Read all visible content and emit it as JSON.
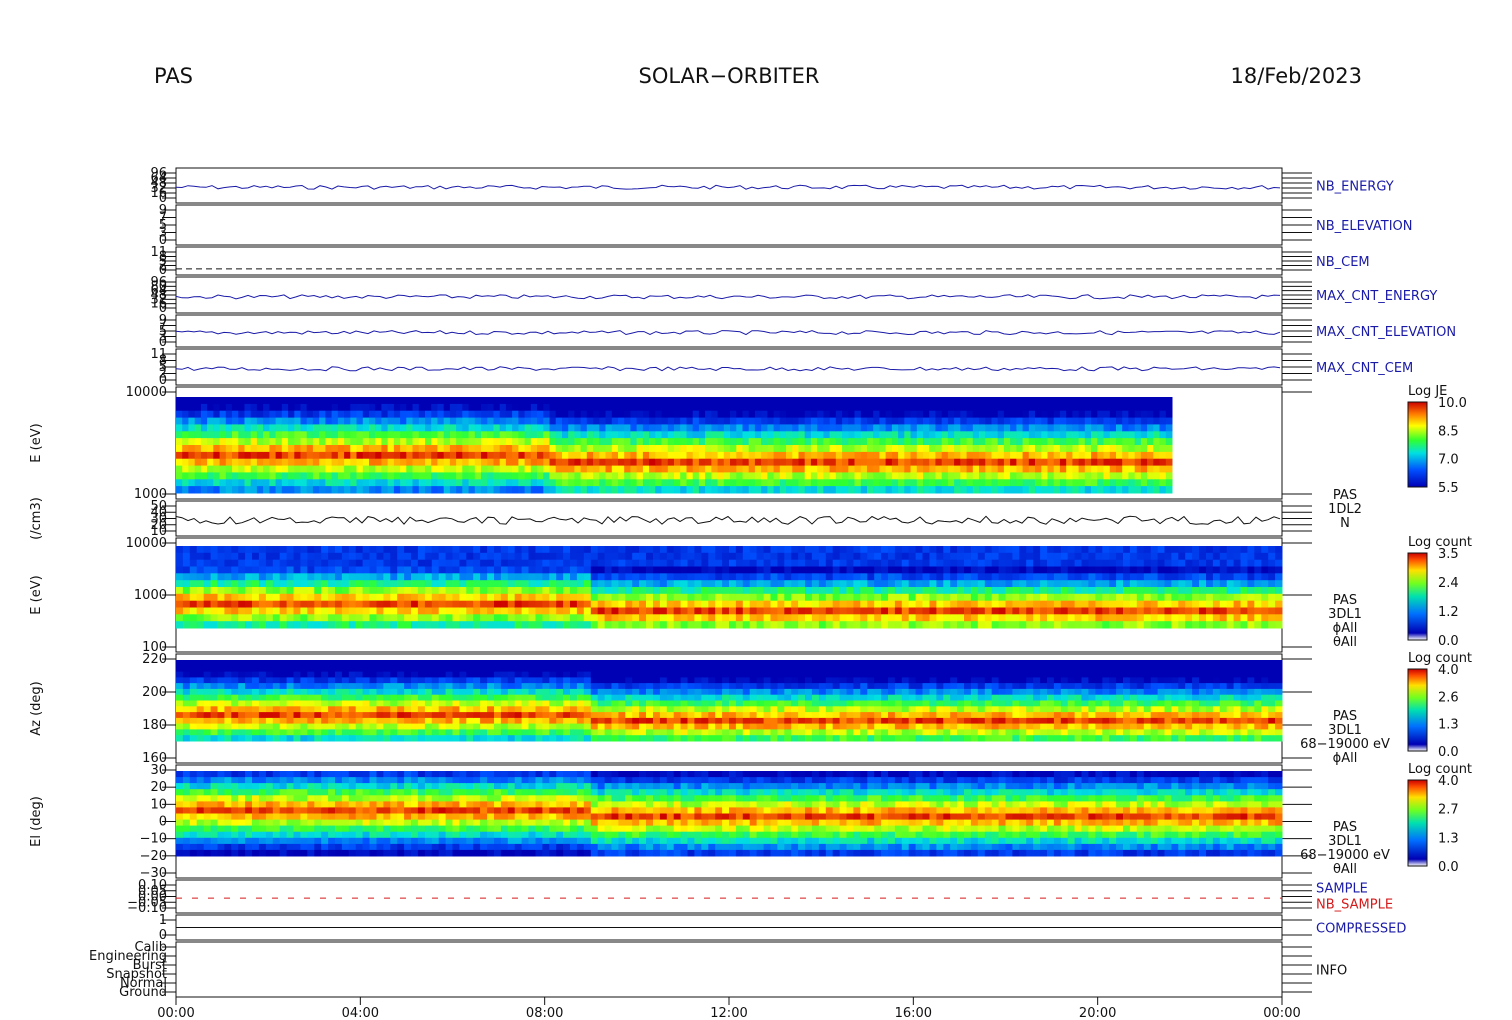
{
  "header": {
    "left": "PAS",
    "center": "SOLAR−ORBITER",
    "right": "18/Feb/2023"
  },
  "chart_data": {
    "type": "heatmap",
    "x_ticks": [
      "00:00",
      "04:00",
      "08:00",
      "12:00",
      "16:00",
      "20:00",
      "00:00"
    ],
    "panels": [
      {
        "id": "nb_energy",
        "right_label": "NB_ENERGY",
        "label_color": "blue",
        "y_ticks": [
          "96",
          "64",
          "48",
          "32",
          "16",
          "0"
        ]
      },
      {
        "id": "nb_elevation",
        "right_label": "NB_ELEVATION",
        "label_color": "blue",
        "y_ticks": [
          "9",
          "7",
          "5",
          "3",
          "0"
        ]
      },
      {
        "id": "nb_cem",
        "right_label": "NB_CEM",
        "label_color": "blue",
        "y_ticks": [
          "11",
          "8",
          "5",
          "2",
          "0"
        ]
      },
      {
        "id": "max_cnt_energy",
        "right_label": "MAX_CNT_ENERGY",
        "label_color": "blue",
        "y_ticks": [
          "96",
          "80",
          "64",
          "48",
          "32",
          "16",
          "0"
        ]
      },
      {
        "id": "max_cnt_elevation",
        "right_label": "MAX_CNT_ELEVATION",
        "label_color": "blue",
        "y_ticks": [
          "9",
          "7",
          "5",
          "3",
          "0"
        ]
      },
      {
        "id": "max_cnt_cem",
        "right_label": "MAX_CNT_CEM",
        "label_color": "blue",
        "y_ticks": [
          "11",
          "8",
          "5",
          "2",
          "0"
        ]
      },
      {
        "id": "je_spectrogram",
        "ylabel": "E (eV)",
        "y_ticks": [
          "10000",
          "1000"
        ],
        "colorbar": {
          "title": "Log JE",
          "ticks": [
            "10.0",
            "8.5",
            "7.0",
            "5.5"
          ]
        }
      },
      {
        "id": "density",
        "ylabel": "(/cm3)",
        "y_ticks": [
          "50",
          "40",
          "30",
          "20",
          "10"
        ],
        "right_labels": [
          "PAS",
          "1DL2",
          "N"
        ]
      },
      {
        "id": "energy_counts",
        "ylabel": "E (eV)",
        "y_ticks": [
          "10000",
          "1000",
          "100"
        ],
        "right_labels": [
          "PAS",
          "3DL1",
          "ϕAll",
          "θAll"
        ],
        "colorbar": {
          "title": "Log count",
          "ticks": [
            "3.5",
            "2.4",
            "1.2",
            "0.0"
          ]
        }
      },
      {
        "id": "azimuth",
        "ylabel": "Az (deg)",
        "y_ticks": [
          "220",
          "200",
          "180",
          "160"
        ],
        "right_labels": [
          "PAS",
          "3DL1",
          "68−19000 eV",
          "ϕAll"
        ],
        "colorbar": {
          "title": "Log count",
          "ticks": [
            "4.0",
            "2.6",
            "1.3",
            "0.0"
          ]
        }
      },
      {
        "id": "elevation",
        "ylabel": "El (deg)",
        "y_ticks": [
          "30",
          "20",
          "10",
          "0",
          "−10",
          "−20",
          "−30"
        ],
        "right_labels": [
          "PAS",
          "3DL1",
          "68−19000 eV",
          "θAll"
        ],
        "colorbar": {
          "title": "Log count",
          "ticks": [
            "4.0",
            "2.7",
            "1.3",
            "0.0"
          ]
        }
      },
      {
        "id": "sample",
        "right_label": "SAMPLE",
        "right_label2": "NB_SAMPLE",
        "y_ticks": [
          "0.10",
          "0.05",
          "0.00",
          "−0.05",
          "−0.10"
        ]
      },
      {
        "id": "compressed",
        "right_label": "COMPRESSED",
        "label_color": "blue",
        "y_ticks": [
          "1",
          "0"
        ]
      },
      {
        "id": "info",
        "right_label": "INFO",
        "label_color": "black",
        "y_ticks": [
          "Calib",
          "Engineering",
          "Burst",
          "Snapshot",
          "Normal",
          "Ground"
        ]
      }
    ]
  },
  "colors": {
    "blue_label": "#1a1aa8",
    "red_label": "#d41a1a"
  }
}
